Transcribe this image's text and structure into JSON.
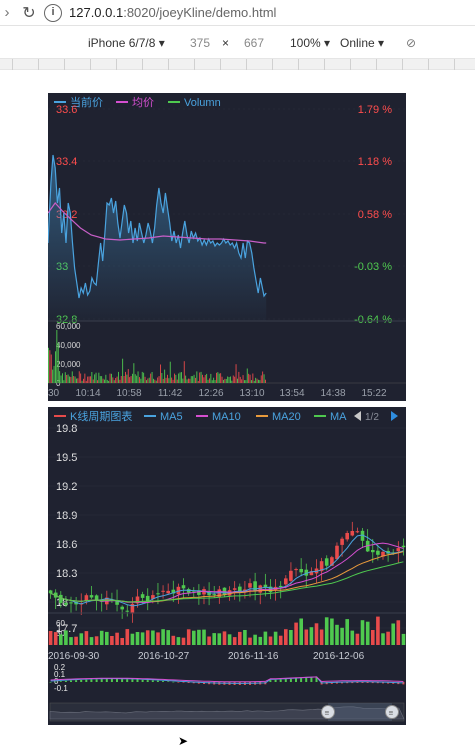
{
  "browser": {
    "url_host": "127.0.0.1",
    "url_port_path": ":8020/joeyKline/demo.html"
  },
  "devtools": {
    "device": "iPhone 6/7/8",
    "width": "375",
    "times": "×",
    "height": "667",
    "zoom": "100%",
    "network": "Online"
  },
  "intraday": {
    "legend": [
      {
        "label": "当前价",
        "color": "#4aa3df"
      },
      {
        "label": "均价",
        "color": "#d54fd0"
      },
      {
        "label": "Volumn",
        "color": "#4fc94f"
      }
    ],
    "price_ticks": [
      "33.6",
      "33.4",
      "33.2",
      "33",
      "32.8"
    ],
    "price_tick_colors": [
      "#ff4d4d",
      "#ff4d4d",
      "#ff4d4d",
      "#4fc94f",
      "#4fc94f"
    ],
    "pct_ticks": [
      "1.79 %",
      "1.18 %",
      "0.58 %",
      "-0.03 %",
      "-0.64 %"
    ],
    "volume_ticks": [
      "60,000",
      "40,000",
      "20,000",
      "0"
    ],
    "time_ticks": [
      "30",
      "10:14",
      "10:58",
      "11:42",
      "12:26",
      "13:10",
      "13:54",
      "14:38",
      "15:22"
    ]
  },
  "kline": {
    "legend": [
      {
        "label": "K线周期图表",
        "color": "#e84b4b"
      },
      {
        "label": "MA5",
        "color": "#4aa3df"
      },
      {
        "label": "MA10",
        "color": "#d54fd0"
      },
      {
        "label": "MA20",
        "color": "#e89a3c"
      },
      {
        "label": "MA",
        "color": "#4fc94f"
      }
    ],
    "page": "1/2",
    "price_ticks": [
      "19.8",
      "19.5",
      "19.2",
      "18.9",
      "18.6",
      "18.3",
      "18",
      "17.7"
    ],
    "volume_ticks": [
      "60",
      "30"
    ],
    "date_ticks": [
      "2016-09-30",
      "2016-10-27",
      "2016-11-16",
      "2016-12-06"
    ],
    "macd_ticks": [
      "0.2",
      "0.1",
      "0",
      "-0.1"
    ]
  }
}
